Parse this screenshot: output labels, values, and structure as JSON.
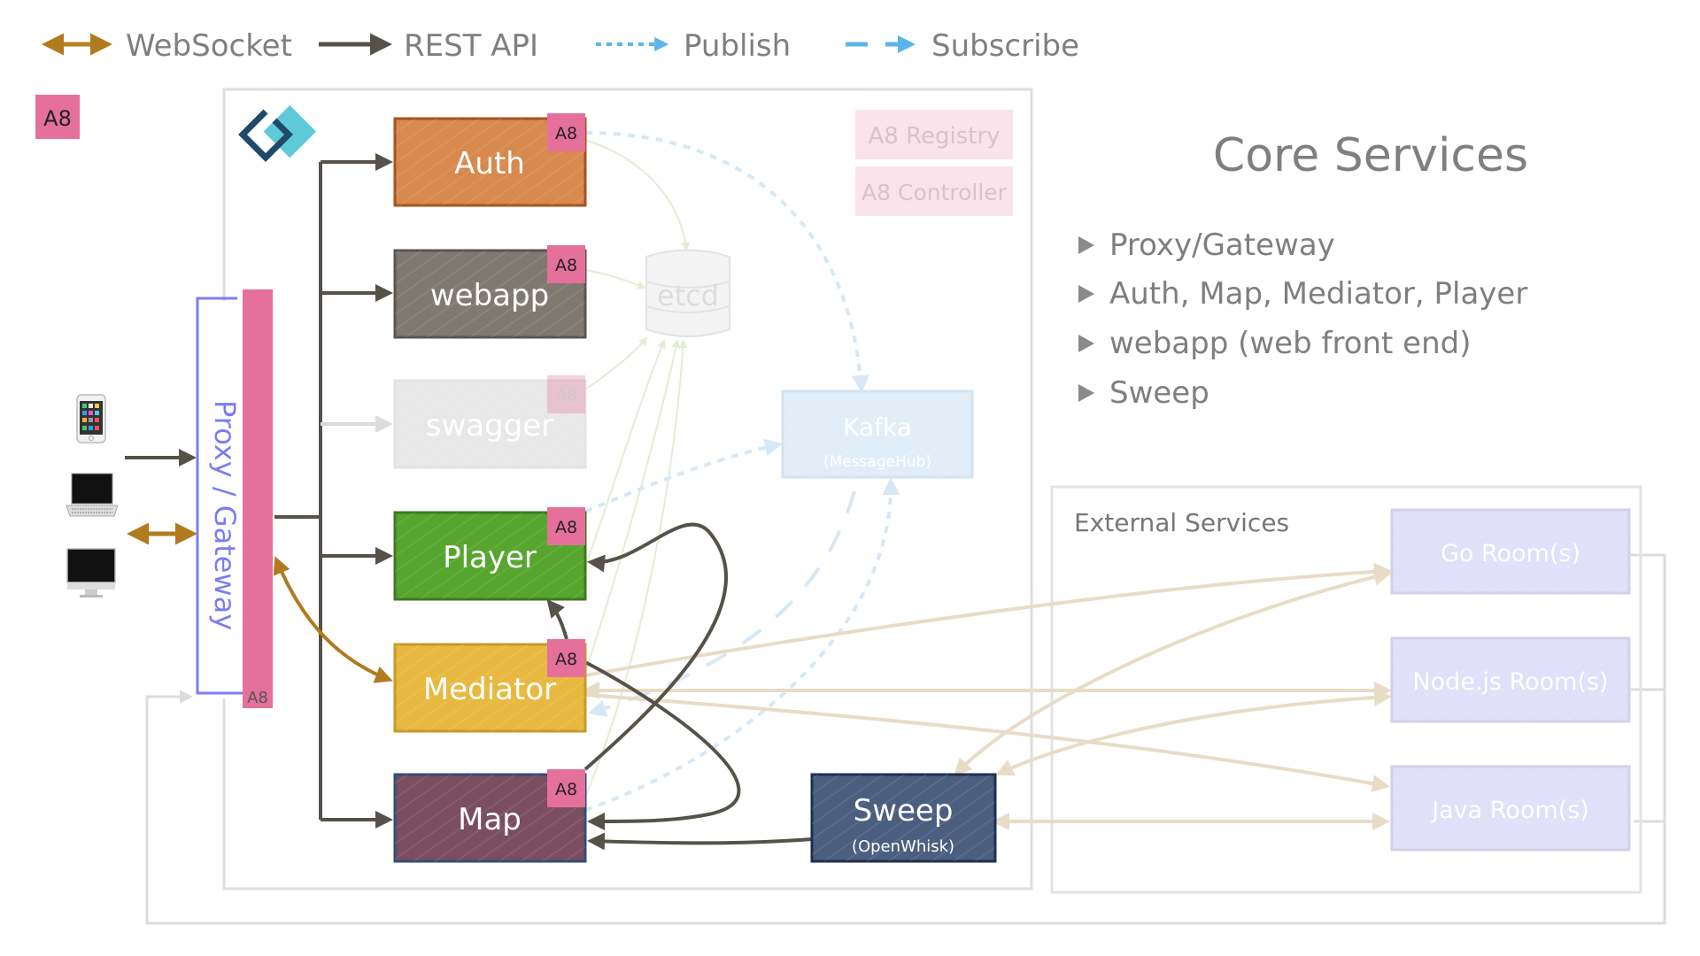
{
  "legend": [
    {
      "label": "WebSocket",
      "kind": "websocket",
      "color": "#b8801e"
    },
    {
      "label": "REST API",
      "kind": "rest",
      "color": "#565249"
    },
    {
      "label": "Publish",
      "kind": "publish",
      "color": "#5cb5e8"
    },
    {
      "label": "Subscribe",
      "kind": "subscribe",
      "color": "#5cb5e8"
    }
  ],
  "a8_badge": "A8",
  "proxy": {
    "label": "Proxy / Gateway",
    "a8": "A8"
  },
  "clients": [
    {
      "name": "phone-icon",
      "label": "Mobile phone"
    },
    {
      "name": "laptop-icon",
      "label": "Laptop"
    },
    {
      "name": "desktop-icon",
      "label": "Desktop"
    }
  ],
  "services": [
    {
      "id": "auth",
      "label": "Auth",
      "a8": "A8",
      "color": "#d7894e",
      "border": "#a8521e",
      "faded": false
    },
    {
      "id": "webapp",
      "label": "webapp",
      "a8": "A8",
      "color": "#807972",
      "border": "#5a554f",
      "faded": false
    },
    {
      "id": "swagger",
      "label": "swagger",
      "a8": "A8",
      "color": "#e6e6e6",
      "border": "#e0e0e0",
      "faded": true
    },
    {
      "id": "player",
      "label": "Player",
      "a8": "A8",
      "color": "#56a52e",
      "border": "#3d7a1d",
      "faded": false
    },
    {
      "id": "mediator",
      "label": "Mediator",
      "a8": "A8",
      "color": "#e8b940",
      "border": "#c9982a",
      "faded": false
    },
    {
      "id": "map",
      "label": "Map",
      "a8": "A8",
      "color": "#7b4d60",
      "border": "#2f4e7a",
      "faded": false
    }
  ],
  "etcd": {
    "label": "etcd"
  },
  "kafka": {
    "label": "Kafka",
    "sublabel": "(MessageHub)"
  },
  "sweep": {
    "label": "Sweep",
    "sublabel": "(OpenWhisk)"
  },
  "a8_registry": "A8 Registry",
  "a8_controller": "A8 Controller",
  "core": {
    "title": "Core Services",
    "bullets": [
      "Proxy/Gateway",
      "Auth, Map, Mediator, Player",
      "webapp (web front end)",
      "Sweep"
    ]
  },
  "external": {
    "title": "External Services",
    "rooms": [
      "Go Room(s)",
      "Node.js Room(s)",
      "Java Room(s)"
    ]
  },
  "colors": {
    "a8_pink": "#e5709c",
    "proxy_blue": "#7b7ef0",
    "rest": "#565249",
    "websocket": "#b07a1e",
    "room_fill": "#e0e0fa",
    "room_arrow": "#e8dcc6",
    "kafka_fill": "#e1eef8"
  }
}
